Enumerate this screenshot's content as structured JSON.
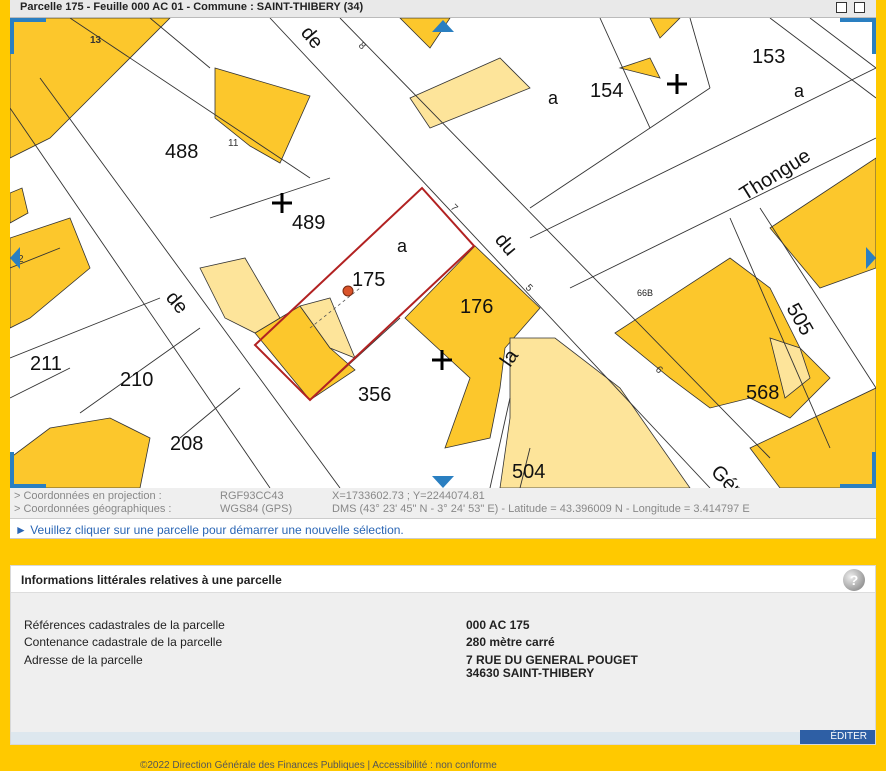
{
  "title": "Parcelle 175 - Feuille 000 AC 01 - Commune : SAINT-THIBERY (34)",
  "map": {
    "parcels": [
      "13",
      "153",
      "154",
      "488",
      "489",
      "175",
      "176",
      "211",
      "210",
      "208",
      "356",
      "504",
      "505",
      "568",
      "66B"
    ],
    "sections": {
      "a1": "a",
      "a2": "a",
      "a3": "a"
    },
    "numbers": {
      "n11": "11",
      "n7": "7",
      "n5": "5",
      "n6": "6",
      "n8": "8",
      "n2": "2"
    },
    "streets": {
      "thongue": "Thongue",
      "du": "du",
      "de": "de",
      "la": "la",
      "ger": "Gér",
      "de_top": "de"
    }
  },
  "coords": {
    "proj_label": "> Coordonnées en projection :",
    "proj_system": "RGF93CC43",
    "proj_value": "X=1733602.73 ; Y=2244074.81",
    "geo_label": "> Coordonnées géographiques :",
    "geo_system": "WGS84 (GPS)",
    "geo_value": "DMS (43° 23' 45\" N - 3° 24' 53\" E) - Latitude = 43.396009 N - Longitude = 3.414797 E"
  },
  "notice": "► Veuillez cliquer sur une parcelle pour démarrer une nouvelle sélection.",
  "panel": {
    "title": "Informations littérales relatives à une parcelle",
    "rows": [
      {
        "label": "Références cadastrales de la parcelle",
        "value": "000 AC 175"
      },
      {
        "label": "Contenance cadastrale de la parcelle",
        "value": "280 mètre carré"
      },
      {
        "label": "Adresse de la parcelle",
        "value": "7 RUE DU GENERAL POUGET",
        "value2": "34630 SAINT-THIBERY"
      }
    ],
    "edit_label": "ÉDITER"
  },
  "footer": "©2022 Direction Générale des Finances Publiques  |  Accessibilité : non conforme",
  "colors": {
    "parcel_yellow": "#fcc72c",
    "light_yellow": "#fde49a",
    "selection": "#b22222",
    "nav_blue": "#2a7fc1"
  }
}
